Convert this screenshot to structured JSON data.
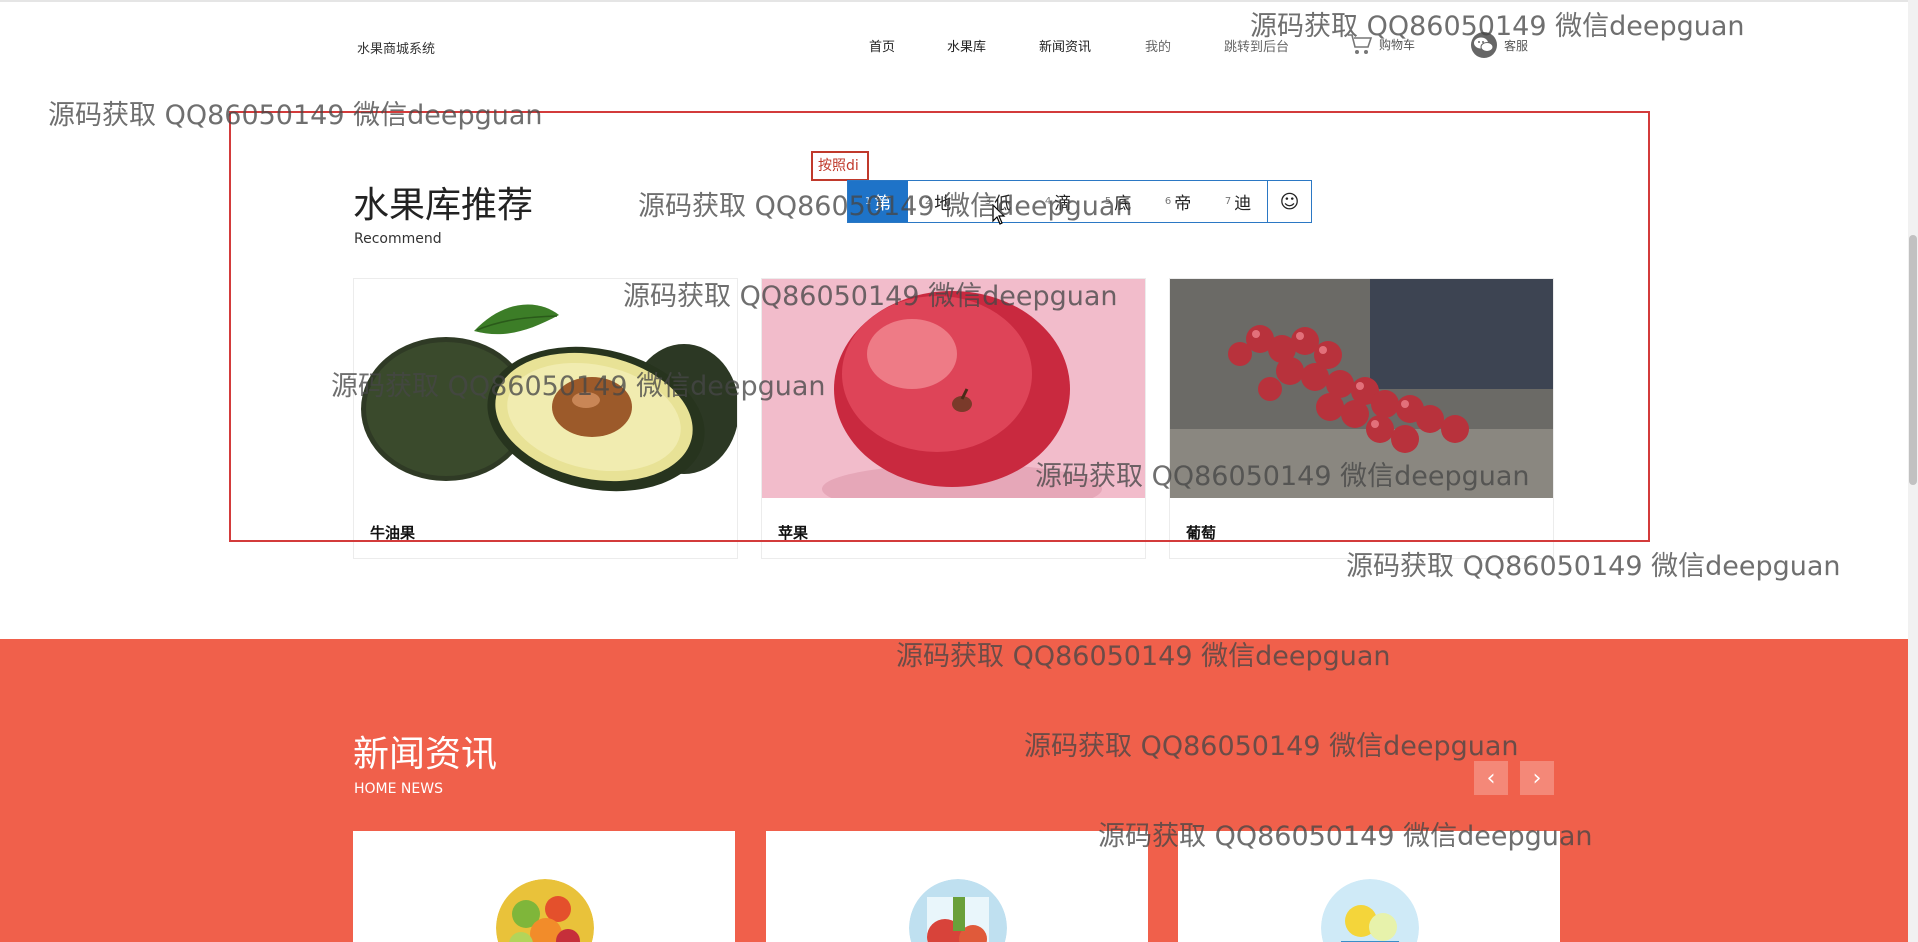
{
  "header": {
    "logo": "水果商城系统",
    "nav": [
      {
        "label": "首页"
      },
      {
        "label": "水果库"
      },
      {
        "label": "新闻资讯"
      },
      {
        "label": "我的"
      },
      {
        "label": "跳转到后台"
      }
    ],
    "cart_label": "购物车",
    "service_label": "客服"
  },
  "ime": {
    "composing": "按照di",
    "candidates": [
      {
        "num": "1",
        "text": "第"
      },
      {
        "num": "2",
        "text": "地"
      },
      {
        "num": "3",
        "text": "低"
      },
      {
        "num": "4",
        "text": "滴"
      },
      {
        "num": "5",
        "text": "底"
      },
      {
        "num": "6",
        "text": "帝"
      },
      {
        "num": "7",
        "text": "迪"
      }
    ],
    "emoji_icon": "smiley-icon"
  },
  "recommend": {
    "title": "水果库推荐",
    "subtitle": "Recommend",
    "items": [
      {
        "name": "牛油果"
      },
      {
        "name": "苹果"
      },
      {
        "name": "葡萄"
      }
    ]
  },
  "news": {
    "title": "新闻资讯",
    "subtitle": "HOME NEWS",
    "prev": "‹",
    "next": "›"
  },
  "watermark": "源码获取 QQ86050149 微信deepguan",
  "colors": {
    "news_bg": "#f0604b",
    "highlight_frame": "#d33b3b",
    "ime_active": "#1e73c8"
  }
}
